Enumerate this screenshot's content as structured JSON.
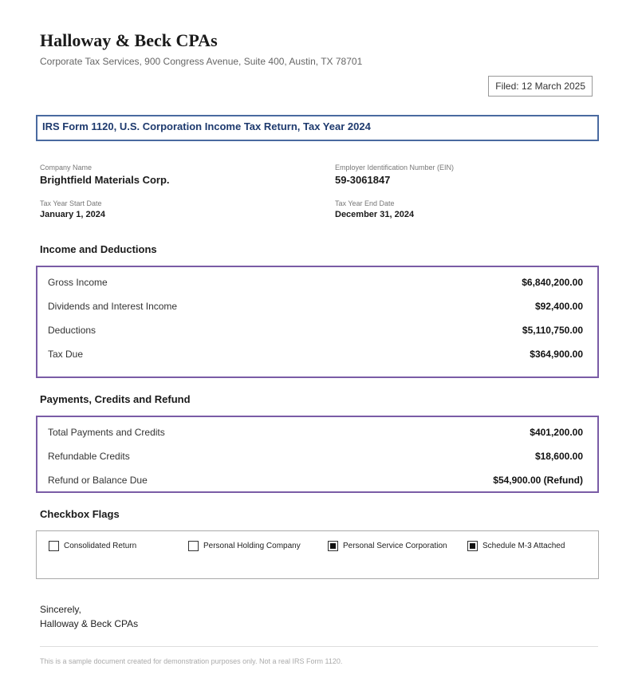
{
  "header": {
    "firm_name": "Halloway & Beck CPAs",
    "firm_address": "Corporate Tax Services, 900 Congress Avenue, Suite 400, Austin, TX 78701",
    "filed": "Filed: 12 March 2025"
  },
  "form": {
    "title": "IRS Form 1120, U.S. Corporation Income Tax Return, Tax Year 2024"
  },
  "info": {
    "company_name_label": "Company Name",
    "company_name": "Brightfield Materials Corp.",
    "ein_label": "Employer Identification Number (EIN)",
    "ein": "59-3061847",
    "start_label": "Tax Year Start Date",
    "start": "January 1, 2024",
    "end_label": "Tax Year End Date",
    "end": "December 31, 2024"
  },
  "income": {
    "heading": "Income and Deductions",
    "rows": [
      {
        "label": "Gross Income",
        "value": "$6,840,200.00"
      },
      {
        "label": "Dividends and Interest Income",
        "value": "$92,400.00"
      },
      {
        "label": "Deductions",
        "value": "$5,110,750.00"
      },
      {
        "label": "Tax Due",
        "value": "$364,900.00"
      }
    ]
  },
  "payments": {
    "heading": "Payments, Credits and Refund",
    "rows": [
      {
        "label": "Total Payments and Credits",
        "value": "$401,200.00"
      },
      {
        "label": "Refundable Credits",
        "value": "$18,600.00"
      },
      {
        "label": "Refund or Balance Due",
        "value": "$54,900.00 (Refund)"
      }
    ]
  },
  "flags": {
    "heading": "Checkbox Flags",
    "items": [
      {
        "label": "Consolidated Return",
        "checked": false
      },
      {
        "label": "Personal Holding Company",
        "checked": false
      },
      {
        "label": "Personal Service Corporation",
        "checked": true
      },
      {
        "label": "Schedule M-3 Attached",
        "checked": true
      }
    ]
  },
  "closing": {
    "salutation": "Sincerely,",
    "signature": "Halloway & Beck CPAs"
  },
  "footer": {
    "note": "This is a sample document created for demonstration purposes only. Not a real IRS Form 1120."
  },
  "colors": {
    "title_border": "#4a6aa0",
    "title_text": "#1e3a6e",
    "amount_border": "#7a5ca6"
  }
}
